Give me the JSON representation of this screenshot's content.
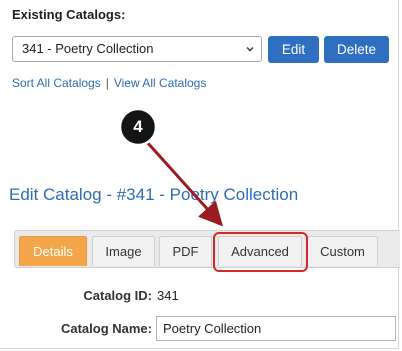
{
  "existing_catalogs": {
    "label": "Existing Catalogs:",
    "selected": "341 - Poetry Collection",
    "edit_label": "Edit",
    "delete_label": "Delete"
  },
  "links": {
    "sort_all": "Sort All Catalogs",
    "separator": "|",
    "view_all": "View All Catalogs"
  },
  "page_title": "Edit Catalog - #341 - Poetry Collection",
  "tabs": [
    {
      "label": "Details",
      "active": true
    },
    {
      "label": "Image",
      "active": false
    },
    {
      "label": "PDF",
      "active": false
    },
    {
      "label": "Advanced",
      "active": false
    },
    {
      "label": "Custom",
      "active": false
    }
  ],
  "form": {
    "catalog_id_label": "Catalog ID:",
    "catalog_id_value": "341",
    "catalog_name_label": "Catalog Name:",
    "catalog_name_value": "Poetry Collection"
  },
  "annotation": {
    "step_number": "4",
    "arrow_color": "#9b1c20",
    "highlight_color": "#d9272e",
    "accent": "#2f6fc2",
    "active_tab_color": "#f5a54a"
  }
}
